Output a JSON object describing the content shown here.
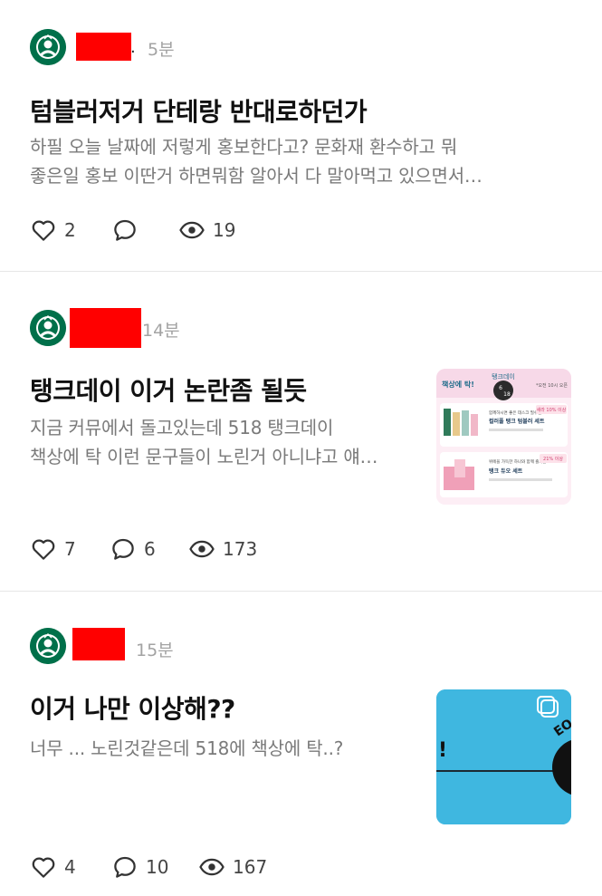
{
  "posts": [
    {
      "time": "5분",
      "dot": ".",
      "title": "텀블러저거 단테랑 반대로하던가",
      "body_lines": [
        "하필 오늘 날짜에 저렇게 홍보한다고?  문화재 환수하고 뭐",
        "좋은일 홍보 이딴거 하면뭐함 알아서 다 말아먹고 있으면서…"
      ],
      "likes": "2",
      "comments": "",
      "views": "19"
    },
    {
      "time": "14분",
      "title": "탱크데이 이거 논란좀 될듯",
      "body_lines": [
        "지금 커뮤에서 돌고있는데 518 탱크데이",
        "책상에 탁 이런 문구들이 노린거 아니냐고 얘…"
      ],
      "likes": "7",
      "comments": "6",
      "views": "173",
      "thumbnail": {
        "header_left": "책상에 탁!",
        "header_center": "탱크데이",
        "badge_top": "6",
        "badge_bottom": "18",
        "header_right": "*오전 10시 오픈",
        "item1_tag": "새라 10% 이상",
        "item1_sub": "함께하시면 좋은 데스크 필수템",
        "item1_title": "컬러풀 탱크 텀블러 세트",
        "item2_tag": "21% 이상",
        "item2_sub": "위에을 가득한 하나와 함께 즐기는",
        "item2_title": "탱크 듀오 세트"
      }
    },
    {
      "time": "15분",
      "title": "이거 나만 이상해??",
      "body_lines": [
        "너무 ... 노린것같은데 518에 책상에 탁..?"
      ],
      "likes": "4",
      "comments": "10",
      "views": "167",
      "thumbnail": {
        "exclaim": "!",
        "logo_text": "EO"
      }
    }
  ],
  "colors": {
    "starbucks_green": "#00704a",
    "redaction": "#ff0000",
    "thumb3_bg": "#3fb7e0"
  },
  "icons": [
    "starbucks-logo-icon",
    "heart-icon",
    "comment-icon",
    "eye-icon"
  ]
}
